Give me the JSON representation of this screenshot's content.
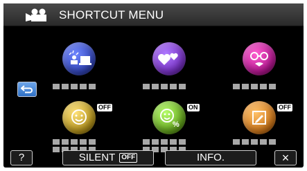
{
  "header": {
    "mode_icon": "video-camera-icon",
    "title": "SHORTCUT MENU"
  },
  "nav": {
    "back_icon": "return-arrow-icon"
  },
  "items": [
    {
      "icon": "scene-select-icon",
      "color": "#3b4bc4",
      "label_masked": true
    },
    {
      "icon": "hearts-icon",
      "color": "#7b32c0",
      "label_masked": true
    },
    {
      "icon": "face-effect-icon",
      "color": "#b0178e",
      "label_masked": true
    },
    {
      "icon": "smiley-face-icon",
      "color": "#b99a22",
      "label_masked": true,
      "state": "OFF"
    },
    {
      "icon": "smile-percent-icon",
      "color": "#66a81f",
      "label_masked": true,
      "state": "ON"
    },
    {
      "icon": "edit-frame-icon",
      "color": "#d27c1e",
      "label_masked": true,
      "state": "OFF"
    }
  ],
  "footer": {
    "help_label": "?",
    "silent_label": "SILENT",
    "silent_state": "OFF",
    "info_label": "INFO.",
    "close_label": "×"
  },
  "colors": {
    "background": "#000000",
    "header": "#3a3a3a",
    "accent_blue": "#3a82d8",
    "masked_text": "#a8a8a8"
  }
}
